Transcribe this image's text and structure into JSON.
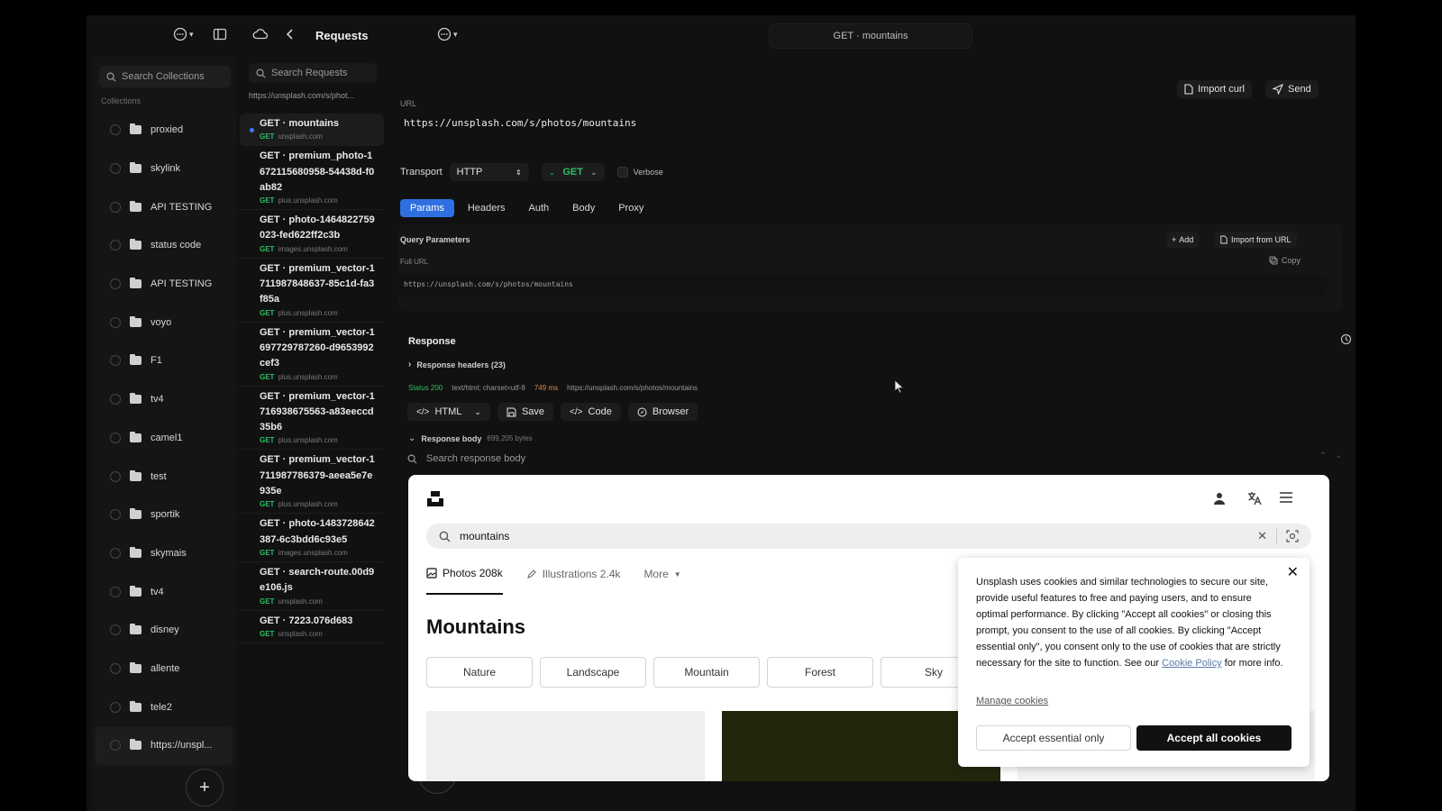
{
  "topbar": {
    "title": "Requests",
    "tab_title": "GET · mountains",
    "workspace_chevron": "▾",
    "env_chevron": "▾"
  },
  "sidebar": {
    "search_placeholder": "Search Collections",
    "section_label": "Collections",
    "items": [
      {
        "label": "proxied"
      },
      {
        "label": "skylink"
      },
      {
        "label": "API TESTING"
      },
      {
        "label": "status code"
      },
      {
        "label": "API TESTING"
      },
      {
        "label": "voyo"
      },
      {
        "label": "F1"
      },
      {
        "label": "tv4"
      },
      {
        "label": "camel1"
      },
      {
        "label": "test"
      },
      {
        "label": "sportik"
      },
      {
        "label": "skymais"
      },
      {
        "label": "tv4"
      },
      {
        "label": "disney"
      },
      {
        "label": "allente"
      },
      {
        "label": "tele2"
      },
      {
        "label": "https://unspl..."
      }
    ],
    "add_label": "+"
  },
  "requests": {
    "search_placeholder": "Search Requests",
    "current_url": "https://unsplash.com/s/phot...",
    "items": [
      {
        "name": "GET · mountains",
        "method": "GET",
        "host": "unsplash.com"
      },
      {
        "name": "GET · premium_photo-1672115680958-54438d-f0ab82",
        "method": "GET",
        "host": "plus.unsplash.com"
      },
      {
        "name": "GET · photo-1464822759023-fed622ff2c3b",
        "method": "GET",
        "host": "images.unsplash.com"
      },
      {
        "name": "GET · premium_vector-1711987848637-85c1d-fa3f85a",
        "method": "GET",
        "host": "plus.unsplash.com"
      },
      {
        "name": "GET · premium_vector-1697729787260-d9653992cef3",
        "method": "GET",
        "host": "plus.unsplash.com"
      },
      {
        "name": "GET · premium_vector-1716938675563-a83eeccd35b6",
        "method": "GET",
        "host": "plus.unsplash.com"
      },
      {
        "name": "GET · premium_vector-1711987786379-aeea5e7e935e",
        "method": "GET",
        "host": "plus.unsplash.com"
      },
      {
        "name": "GET · photo-1483728642387-6c3bdd6c93e5",
        "method": "GET",
        "host": "images.unsplash.com"
      },
      {
        "name": "GET · search-route.00d9e106.js",
        "method": "GET",
        "host": "unsplash.com"
      },
      {
        "name": "GET · 7223.076d683",
        "method": "GET",
        "host": "unsplash.com"
      }
    ],
    "add_label": "+"
  },
  "main": {
    "import_curl": "Import curl",
    "send": "Send",
    "url_label": "URL",
    "url_value": "https://unsplash.com/s/photos/mountains",
    "transport_label": "Transport",
    "transport_value": "HTTP",
    "method_value": "GET",
    "verbose_label": "Verbose",
    "tabs": [
      {
        "label": "Params"
      },
      {
        "label": "Headers"
      },
      {
        "label": "Auth"
      },
      {
        "label": "Body"
      },
      {
        "label": "Proxy"
      }
    ],
    "query_params_label": "Query Parameters",
    "add_label": "Add",
    "import_from_url": "Import from URL",
    "full_url_label": "Full URL",
    "copy_label": "Copy",
    "full_url_value": "https://unsplash.com/s/photos/mountains"
  },
  "response": {
    "title": "Response",
    "headers_label": "Response headers (23)",
    "status": "Status 200",
    "content_type": "text/html; charset=utf-8",
    "time": "749 ms",
    "url": "https://unsplash.com/s/photos/mountains",
    "actions": [
      {
        "label": "HTML"
      },
      {
        "label": "Save"
      },
      {
        "label": "Code"
      },
      {
        "label": "Browser"
      }
    ],
    "body_label": "Response body",
    "body_size": "699,205 bytes",
    "search_placeholder": "Search response body"
  },
  "preview": {
    "search_value": "mountains",
    "tabs": [
      {
        "label": "Photos 208k"
      },
      {
        "label": "Illustrations 2.4k"
      },
      {
        "label": "More"
      }
    ],
    "heading": "Mountains",
    "chips": [
      {
        "label": "Nature"
      },
      {
        "label": "Landscape"
      },
      {
        "label": "Mountain"
      },
      {
        "label": "Forest"
      },
      {
        "label": "Sky"
      }
    ],
    "cookie": {
      "text_before": "Unsplash uses cookies and similar technologies to secure our site, provide useful features to free and paying users, and to ensure optimal performance. By clicking \"Accept all cookies\" or closing this prompt, you consent to the use of all cookies. By clicking \"Accept essential only\", you consent only to the use of cookies that are strictly necessary for the site to function. See our ",
      "link_text": "Cookie Policy",
      "text_after": " for more info.",
      "manage": "Manage cookies",
      "essential": "Accept essential only",
      "accept_all": "Accept all cookies"
    }
  },
  "colors": {
    "accent": "#2f6fe0",
    "status_ok": "#2fbf60",
    "timing": "#e3893b"
  }
}
